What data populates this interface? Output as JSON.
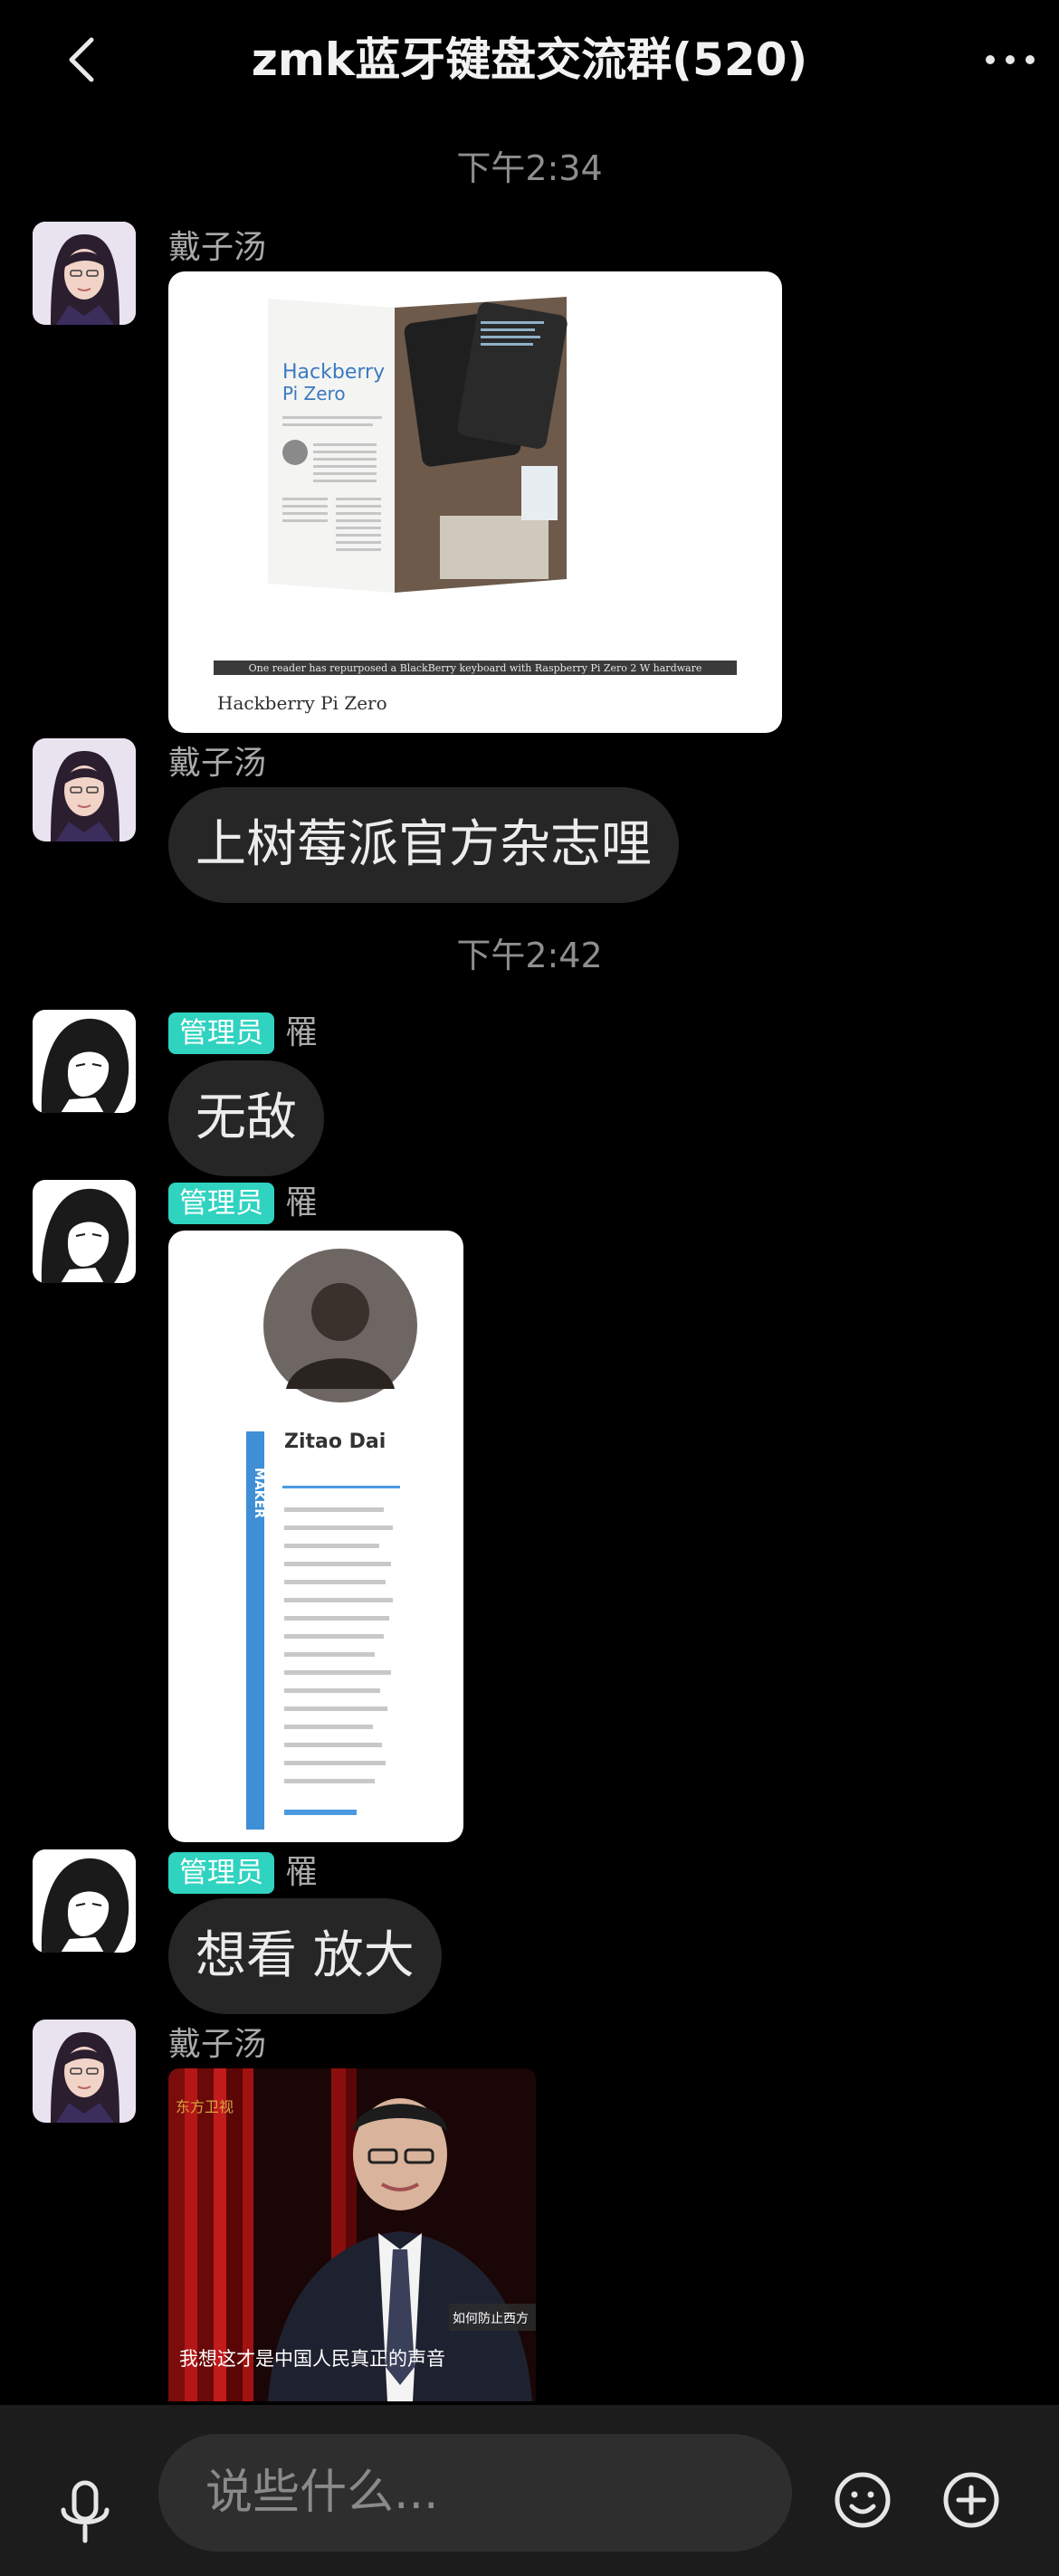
{
  "header": {
    "title": "zmk蓝牙键盘交流群(520)",
    "back_icon": "chevron-left-icon",
    "more_icon": "ellipsis-icon"
  },
  "timestamps": [
    "下午2:34",
    "下午2:42"
  ],
  "messages": [
    {
      "sender": "戴子汤",
      "type": "image",
      "image_text": {
        "headline": "Hackberry",
        "subhead": "Pi Zero",
        "caption_strip": "One reader has repurposed a BlackBerry keyboard with Raspberry Pi Zero 2 W hardware",
        "caption": "Hackberry Pi Zero"
      }
    },
    {
      "sender": "戴子汤",
      "type": "text",
      "text": "上树莓派官方杂志哩"
    },
    {
      "sender": "罹",
      "badge": "管理员",
      "type": "text",
      "text": "无敌"
    },
    {
      "sender": "罹",
      "badge": "管理员",
      "type": "image",
      "image_text": {
        "side_label": "MAKER",
        "name": "Zitao Dai"
      }
    },
    {
      "sender": "罹",
      "badge": "管理员",
      "type": "text",
      "text": "想看 放大"
    },
    {
      "sender": "戴子汤",
      "type": "video",
      "video_text": {
        "subtitle": "我想这才是中国人民真正的声音",
        "tag": "如何防止西方",
        "channel": "东方卫视"
      }
    }
  ],
  "input_bar": {
    "placeholder": "说些什么...",
    "mic_icon": "microphone-icon",
    "emoji_icon": "emoji-icon",
    "plus_icon": "plus-circle-icon"
  },
  "colors": {
    "background": "#000000",
    "bubble": "#262626",
    "admin_badge": "#2fd3c0",
    "input_bar": "#1c1c1c"
  }
}
